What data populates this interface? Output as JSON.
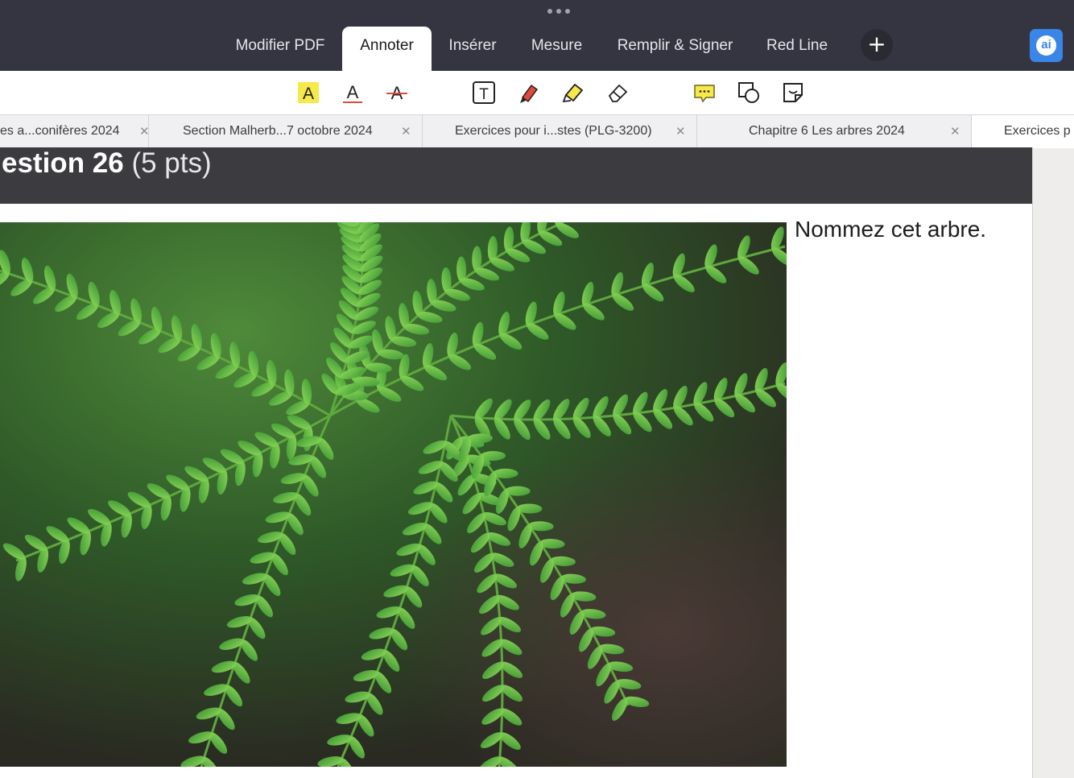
{
  "topbar": {
    "tabs": [
      {
        "label": "Modifier PDF"
      },
      {
        "label": "Annoter"
      },
      {
        "label": "Insérer"
      },
      {
        "label": "Mesure"
      },
      {
        "label": "Remplir & Signer"
      },
      {
        "label": "Red Line"
      }
    ],
    "active_tab": "Annoter",
    "ai_label": "ai"
  },
  "annotation_tools": [
    "highlight-text-icon",
    "underline-text-icon",
    "strikethrough-text-icon",
    "text-box-icon",
    "pen-icon",
    "highlighter-icon",
    "eraser-icon",
    "comment-icon",
    "shapes-icon",
    "sticky-note-icon"
  ],
  "document_tabs": [
    {
      "title": "es a...conifères 2024"
    },
    {
      "title": "Section Malherb...7 octobre 2024"
    },
    {
      "title": "Exercices pour i...stes (PLG-3200)"
    },
    {
      "title": "Chapitre 6 Les arbres  2024"
    },
    {
      "title": "Exercices p"
    }
  ],
  "page": {
    "question_bold": "estion 26",
    "question_points": " (5 pts)",
    "prompt": "Nommez cet arbre."
  },
  "colors": {
    "toolbar_dark": "#353542",
    "accent_blue": "#3a86e8",
    "highlight_yellow": "#f6e94a",
    "annotation_red": "#e04a3a"
  }
}
